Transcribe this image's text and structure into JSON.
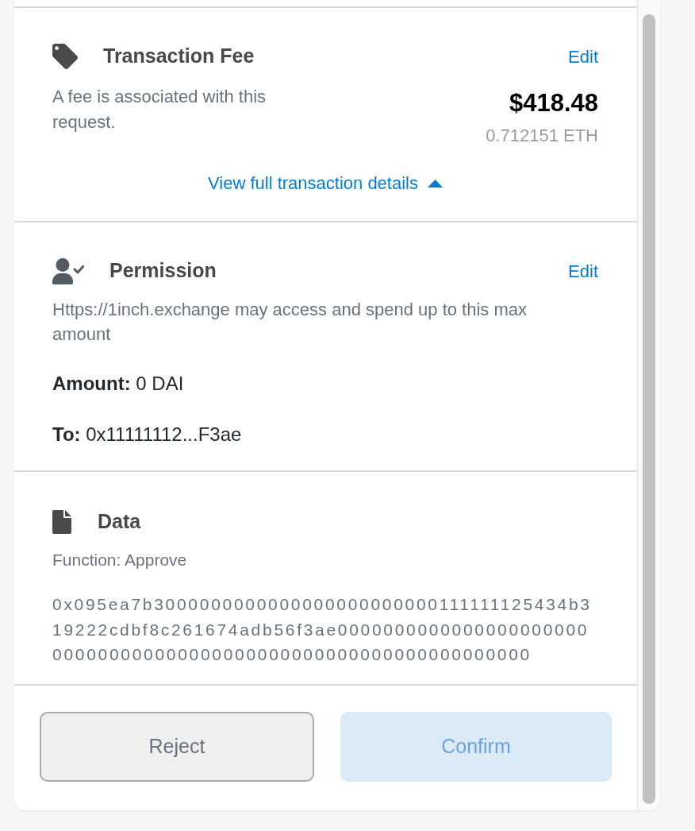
{
  "fee": {
    "title": "Transaction Fee",
    "edit": "Edit",
    "description": "A fee is associated with this request.",
    "amount": "$418.48",
    "amount_eth": "0.712151 ETH",
    "details_link": {
      "label": "View full transaction details",
      "expanded": true
    }
  },
  "permission": {
    "title": "Permission",
    "edit": "Edit",
    "description": "Https://1inch.exchange may access and spend up to this max amount",
    "fields": [
      {
        "label": "Amount:",
        "value": "0 DAI"
      },
      {
        "label": "To:",
        "value": "0x11111112...F3ae"
      }
    ]
  },
  "data": {
    "title": "Data",
    "function": "Function: Approve",
    "hex": "0x095ea7b3000000000000000000000000111111125434b319222cdbf8c261674adb56f3ae0000000000000000000000000000000000000000000000000000000000000000"
  },
  "buttons": [
    {
      "label": "Reject",
      "kind": "secondary",
      "disabled": false
    },
    {
      "label": "Confirm",
      "kind": "primary",
      "disabled": true
    }
  ]
}
